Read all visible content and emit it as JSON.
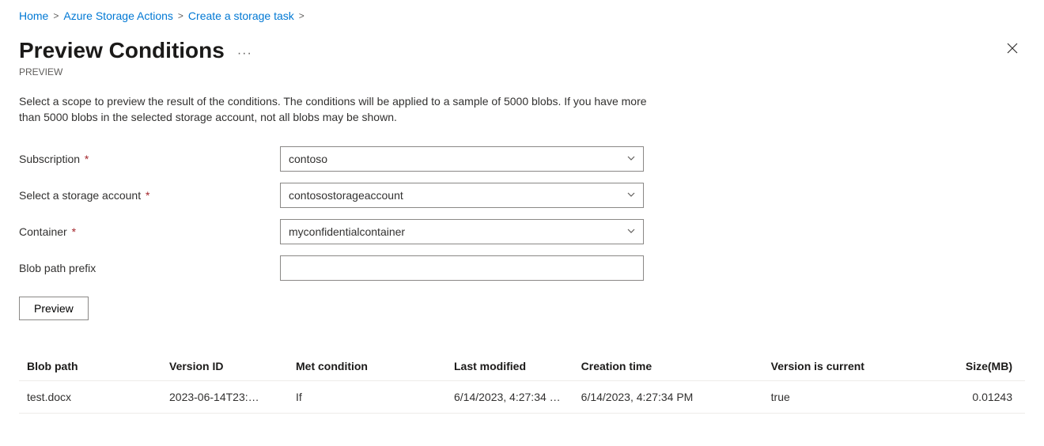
{
  "breadcrumb": {
    "items": [
      {
        "label": "Home"
      },
      {
        "label": "Azure Storage Actions"
      },
      {
        "label": "Create a storage task"
      }
    ]
  },
  "header": {
    "title": "Preview Conditions",
    "subheading": "PREVIEW"
  },
  "description": "Select a scope to preview the result of the conditions. The conditions will be applied to a sample of 5000 blobs. If you have more than 5000 blobs in the selected storage account, not all blobs may be shown.",
  "form": {
    "subscription": {
      "label": "Subscription",
      "value": "contoso",
      "required": true
    },
    "storage_account": {
      "label": "Select a storage account",
      "value": "contosostorageaccount",
      "required": true
    },
    "container": {
      "label": "Container",
      "value": "myconfidentialcontainer",
      "required": true
    },
    "blob_prefix": {
      "label": "Blob path prefix",
      "value": "",
      "required": false
    },
    "preview_button": "Preview"
  },
  "table": {
    "columns": [
      "Blob path",
      "Version ID",
      "Met condition",
      "Last modified",
      "Creation time",
      "Version is current",
      "Size(MB)"
    ],
    "rows": [
      {
        "blob_path": "test.docx",
        "version_id": "2023-06-14T23:…",
        "met_condition": "If",
        "last_modified": "6/14/2023, 4:27:34 …",
        "creation_time": "6/14/2023, 4:27:34 PM",
        "version_is_current": "true",
        "size_mb": "0.01243"
      }
    ]
  }
}
